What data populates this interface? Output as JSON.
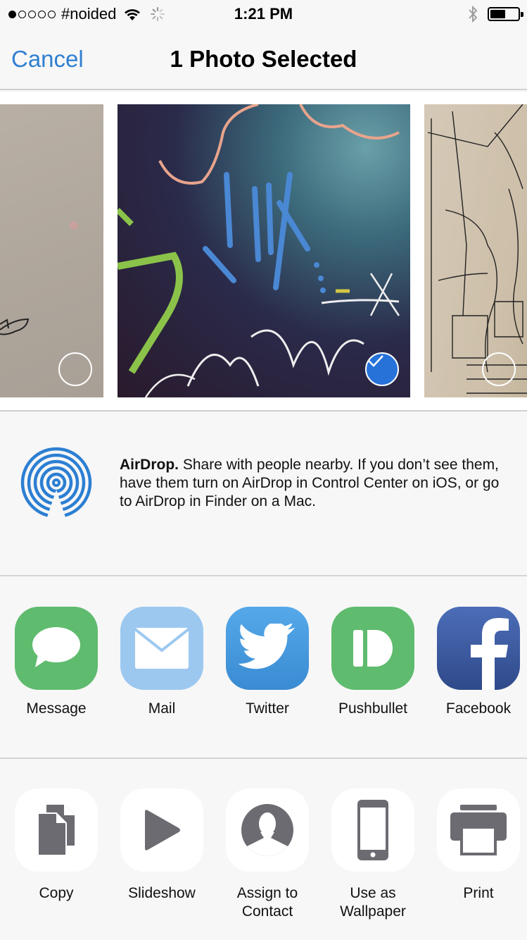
{
  "status_bar": {
    "signal_bars_filled": 1,
    "signal_bars_total": 5,
    "carrier": "#noided",
    "wifi_icon": "wifi-icon",
    "activity_icon": "activity-spinner-icon",
    "time": "1:21 PM",
    "bluetooth_icon": "bluetooth-icon",
    "battery_level_percent": 55
  },
  "navbar": {
    "cancel_label": "Cancel",
    "title": "1 Photo Selected"
  },
  "photos": [
    {
      "name": "beige wall with drawing",
      "selected": false
    },
    {
      "name": "chalk graffiti on dark wall",
      "selected": true
    },
    {
      "name": "pen sketch on paper",
      "selected": false
    }
  ],
  "airdrop": {
    "icon": "airdrop-icon",
    "title": "AirDrop.",
    "description": "Share with people nearby. If you don’t see them, have them turn on AirDrop in Control Center on iOS, or go to AirDrop in Finder on a Mac."
  },
  "share_apps": [
    {
      "label": "Message",
      "icon": "message-icon",
      "color": "#5fbb6e"
    },
    {
      "label": "Mail",
      "icon": "mail-icon",
      "color": "#9cc8f0"
    },
    {
      "label": "Twitter",
      "icon": "twitter-icon",
      "color": "#4a9be0"
    },
    {
      "label": "Pushbullet",
      "icon": "pushbullet-icon",
      "color": "#5fbb6e"
    },
    {
      "label": "Facebook",
      "icon": "facebook-icon",
      "color": "#3b5a9e"
    }
  ],
  "actions": [
    {
      "label": "Copy",
      "icon": "copy-icon"
    },
    {
      "label": "Slideshow",
      "icon": "slideshow-icon"
    },
    {
      "label": "Assign to Contact",
      "icon": "contact-icon"
    },
    {
      "label": "Use as Wallpaper",
      "icon": "wallpaper-icon"
    },
    {
      "label": "Print",
      "icon": "print-icon"
    }
  ],
  "colors": {
    "accent": "#2f80d1",
    "selected_check": "#2672d8",
    "action_icon_gray": "#6c6b72",
    "background": "#f7f7f7"
  }
}
